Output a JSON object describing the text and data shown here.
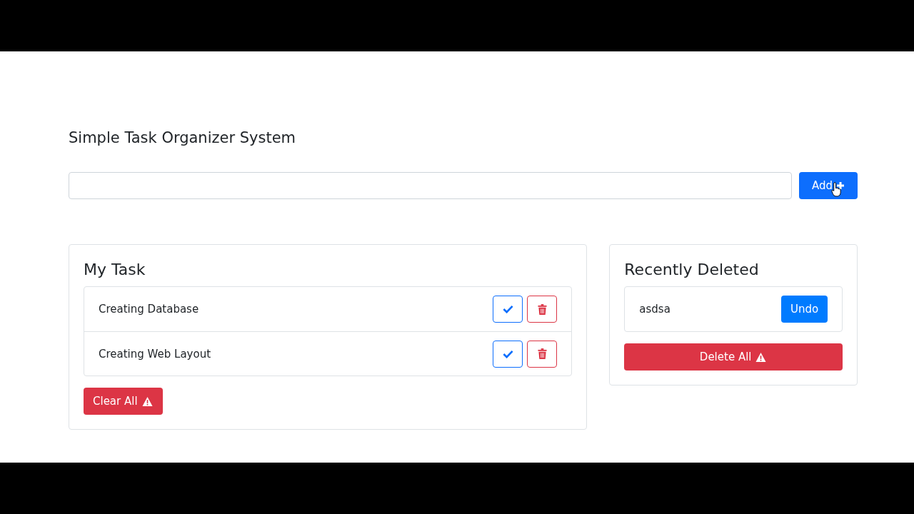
{
  "page_title": "Simple Task Organizer System",
  "add_button": {
    "label": "Add"
  },
  "my_task": {
    "title": "My Task",
    "items": [
      {
        "label": "Creating Database"
      },
      {
        "label": "Creating Web Layout"
      }
    ],
    "clear_button": {
      "label": "Clear All"
    }
  },
  "recently_deleted": {
    "title": "Recently Deleted",
    "items": [
      {
        "label": "asdsa",
        "action": "Undo"
      }
    ],
    "delete_button": {
      "label": "Delete All"
    }
  }
}
